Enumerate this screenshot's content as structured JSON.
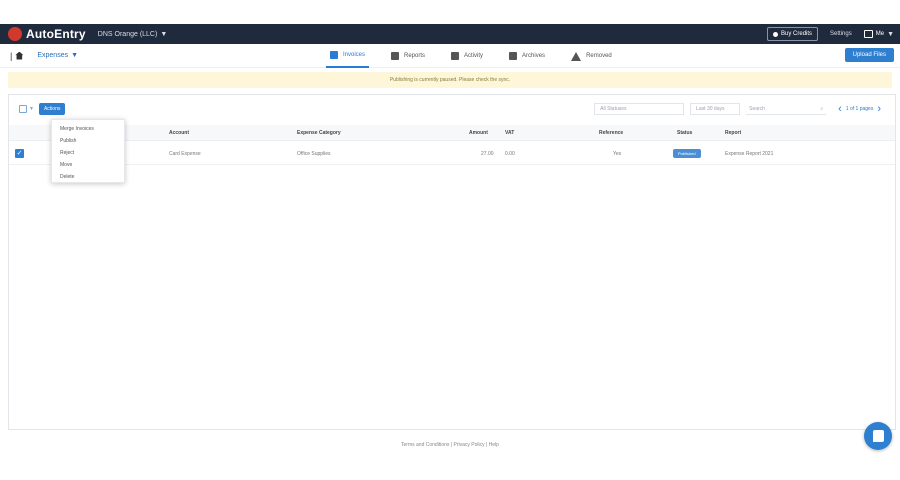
{
  "topbar": {
    "logo": "AutoEntry",
    "org": "DNS Orange (LLC)",
    "buttons": [
      "Buy Credits"
    ],
    "links": [
      "Settings"
    ],
    "user": "Me"
  },
  "nav": {
    "home_sep": "|",
    "docs_selector": "Expenses",
    "tabs": [
      {
        "label": "Invoices",
        "active": true
      },
      {
        "label": "Reports",
        "active": false
      },
      {
        "label": "Activity",
        "active": false
      },
      {
        "label": "Archives",
        "active": false
      },
      {
        "label": "Removed",
        "active": false
      }
    ],
    "upload_label": "Upload Files"
  },
  "banner": {
    "text": "Publishing is currently paused. Please check the sync."
  },
  "toolbar": {
    "actions_label": "Actions",
    "dropdown_items": [
      "Merge Invoices",
      "Publish",
      "Reject",
      "Move",
      "Delete"
    ]
  },
  "filters": {
    "status_filter": "All Statuses",
    "date_filter": "Last 30 days",
    "search_placeholder": "Search",
    "pager_text": "1 of 1 pages"
  },
  "table": {
    "headers": [
      "Account",
      "Expense Category",
      "Amount",
      "VAT",
      "Reference",
      "Status",
      "Report"
    ],
    "rows": [
      {
        "account": "Card Expense",
        "category": "Office Supplies",
        "amount": "27.00",
        "vat": "0.00",
        "reference": "Yes",
        "status": "Published",
        "report": "Expense Report 2021"
      }
    ]
  },
  "footer": {
    "text": "Terms and Conditions | Privacy Policy | Help"
  },
  "colors": {
    "topbar": "#1f2a3c",
    "accent": "#2e7fd0",
    "banner": "#fdf6d8"
  }
}
